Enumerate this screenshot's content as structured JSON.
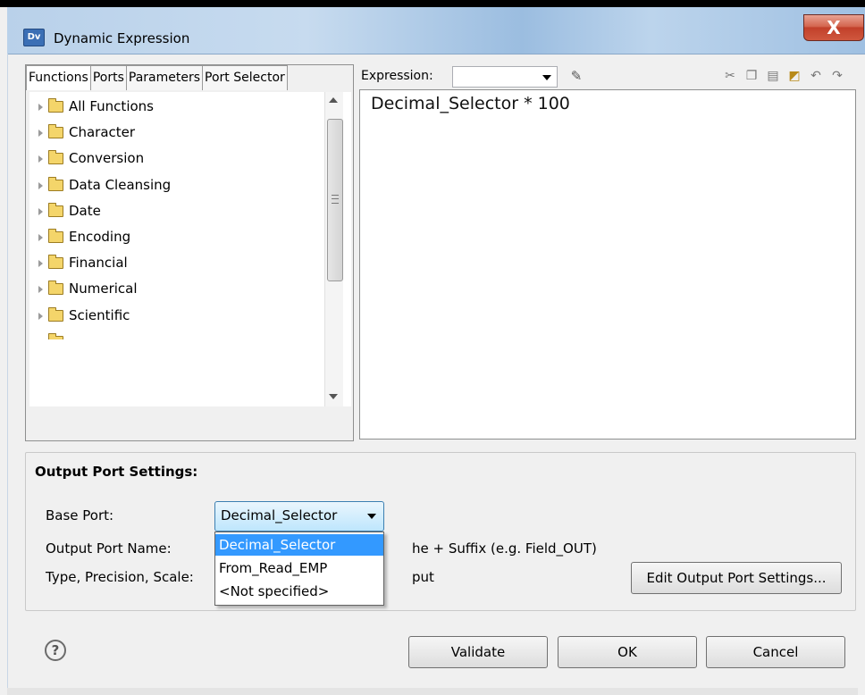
{
  "window": {
    "title": "Dynamic Expression",
    "app_icon_label": "Dv",
    "close_label": "X"
  },
  "tabs": [
    {
      "label": "Functions",
      "active": true
    },
    {
      "label": "Ports",
      "active": false
    },
    {
      "label": "Parameters",
      "active": false
    },
    {
      "label": "Port Selector",
      "active": false
    }
  ],
  "tree": {
    "items": [
      {
        "label": "All Functions",
        "icon": "folder-icon"
      },
      {
        "label": "Character",
        "icon": "folder-icon"
      },
      {
        "label": "Conversion",
        "icon": "folder-icon"
      },
      {
        "label": "Data Cleansing",
        "icon": "folder-icon"
      },
      {
        "label": "Date",
        "icon": "folder-icon"
      },
      {
        "label": "Encoding",
        "icon": "folder-icon"
      },
      {
        "label": "Financial",
        "icon": "folder-icon"
      },
      {
        "label": "Numerical",
        "icon": "folder-icon"
      },
      {
        "label": "Scientific",
        "icon": "folder-icon"
      }
    ]
  },
  "expression": {
    "label": "Expression:",
    "combo_value": "",
    "text": "Decimal_Selector * 100",
    "toolbar_icons": [
      "cut-icon",
      "copy-icon",
      "paste-icon",
      "insert-icon",
      "undo-icon",
      "redo-icon"
    ]
  },
  "output_settings": {
    "heading": "Output Port Settings:",
    "base_port_label": "Base Port:",
    "base_port_value": "Decimal_Selector",
    "output_port_name_label": "Output Port Name:",
    "output_port_name_value": "he + Suffix (e.g. Field_OUT)",
    "type_label": "Type, Precision, Scale:",
    "type_value": "put",
    "edit_button": "Edit Output Port Settings..."
  },
  "dropdown": {
    "options": [
      "Decimal_Selector",
      "From_Read_EMP",
      "<Not specified>"
    ],
    "selected_index": 0
  },
  "buttons": {
    "help": "?",
    "validate": "Validate",
    "ok": "OK",
    "cancel": "Cancel"
  },
  "colors": {
    "selection": "#3399ff",
    "close_button": "#c1402a"
  }
}
